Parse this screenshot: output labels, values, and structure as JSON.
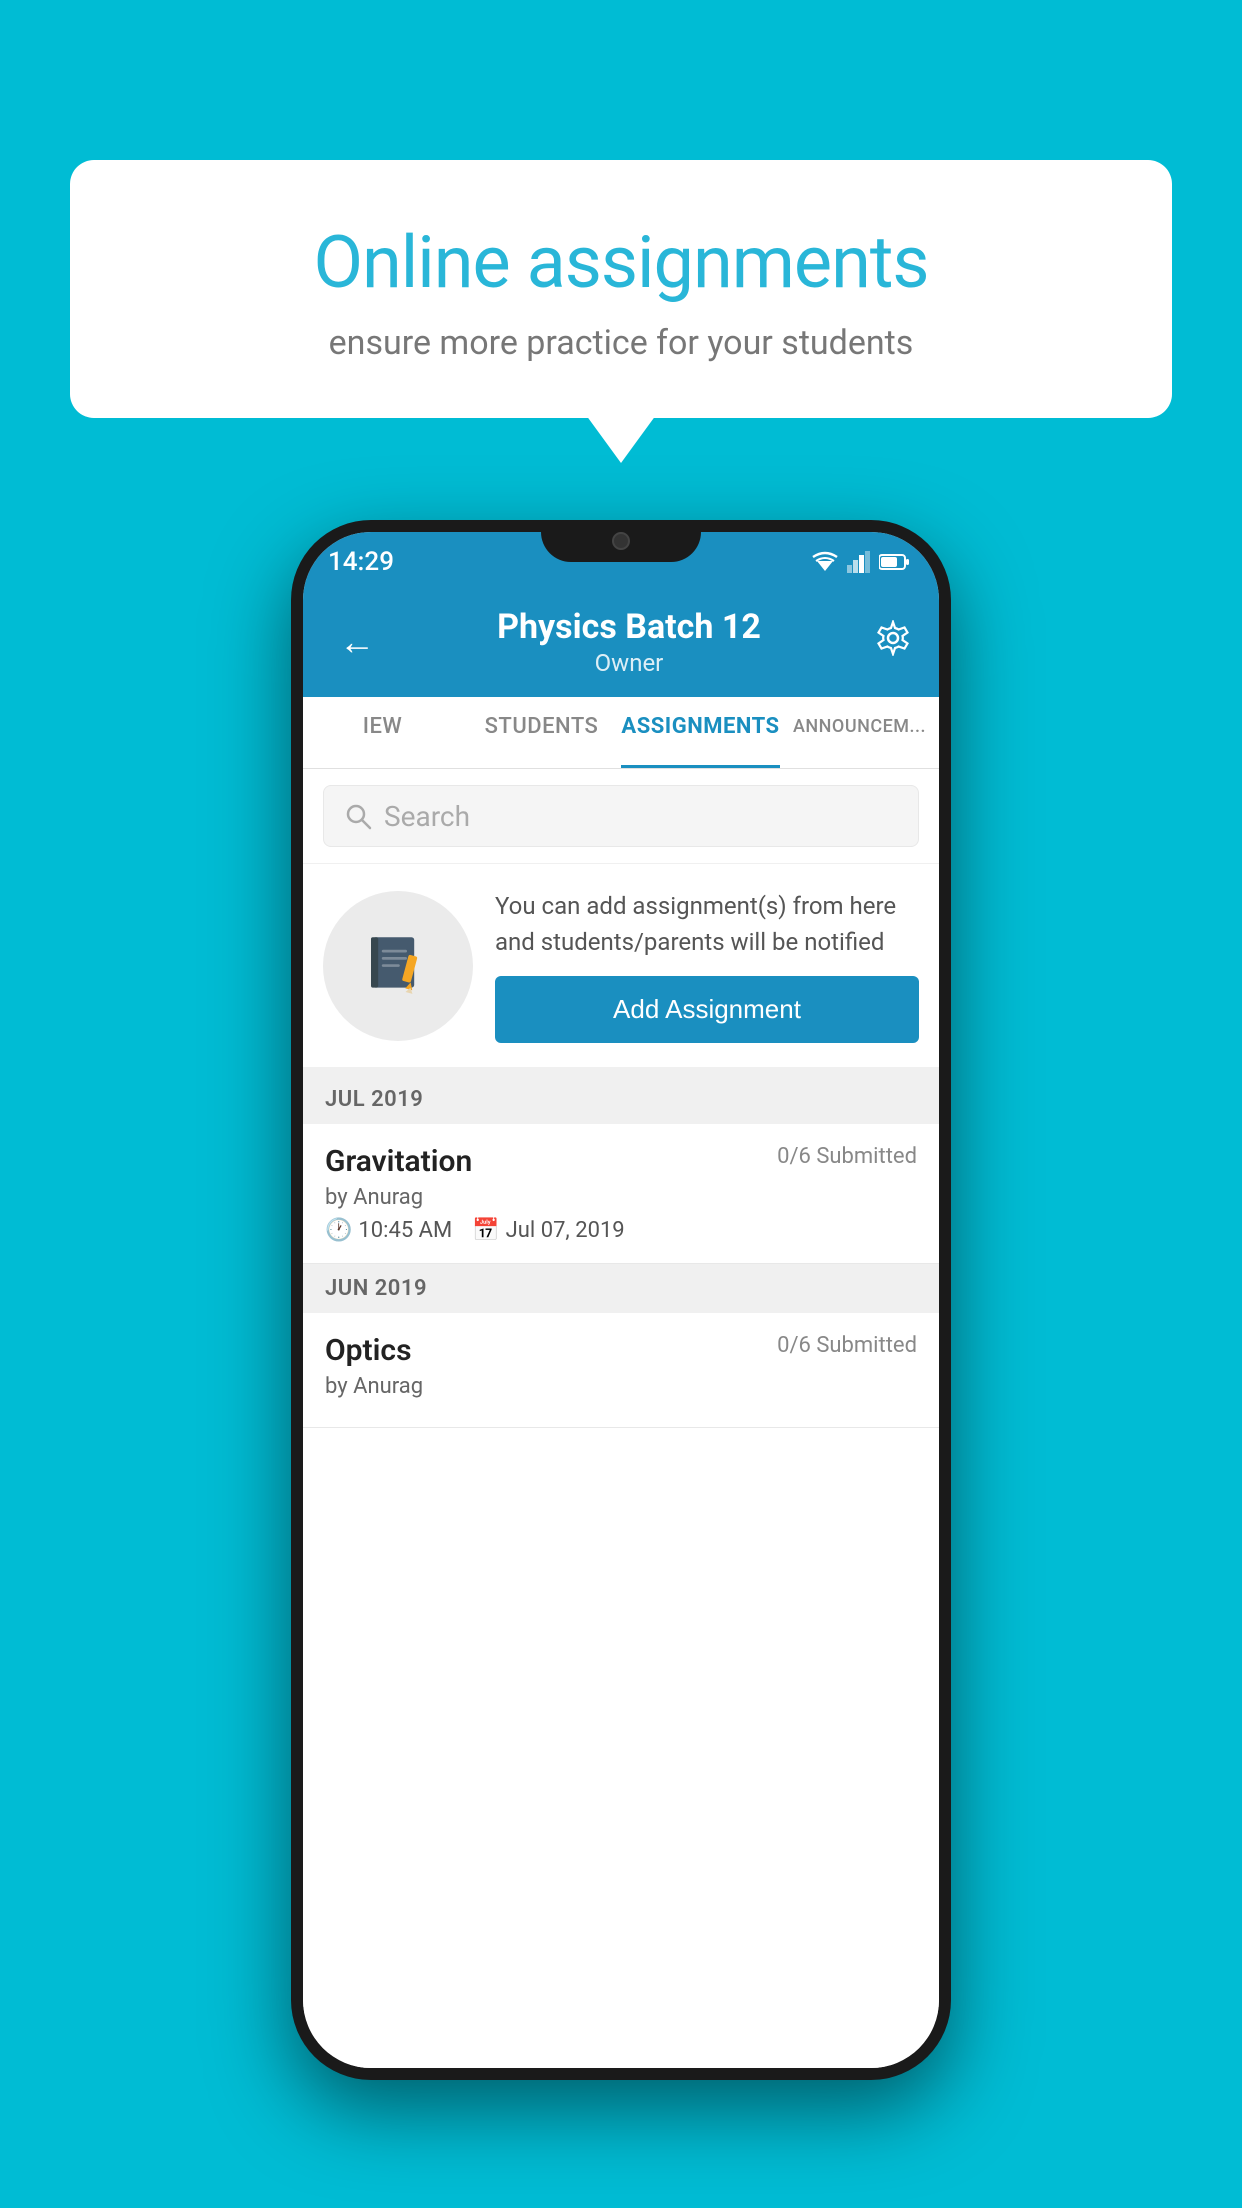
{
  "background_color": "#00bcd4",
  "speech_bubble": {
    "title": "Online assignments",
    "subtitle": "ensure more practice for your students"
  },
  "status_bar": {
    "time": "14:29"
  },
  "header": {
    "title": "Physics Batch 12",
    "subtitle": "Owner"
  },
  "tabs": [
    {
      "label": "IEW",
      "active": false
    },
    {
      "label": "STUDENTS",
      "active": false
    },
    {
      "label": "ASSIGNMENTS",
      "active": true
    },
    {
      "label": "ANNOUNCEM...",
      "active": false
    }
  ],
  "search": {
    "placeholder": "Search"
  },
  "add_assignment_section": {
    "description": "You can add assignment(s) from here and students/parents will be notified",
    "button_label": "Add Assignment"
  },
  "month_groups": [
    {
      "month": "JUL 2019",
      "assignments": [
        {
          "name": "Gravitation",
          "submitted": "0/6 Submitted",
          "by": "by Anurag",
          "time": "10:45 AM",
          "date": "Jul 07, 2019"
        }
      ]
    },
    {
      "month": "JUN 2019",
      "assignments": [
        {
          "name": "Optics",
          "submitted": "0/6 Submitted",
          "by": "by Anurag",
          "time": "",
          "date": ""
        }
      ]
    }
  ]
}
